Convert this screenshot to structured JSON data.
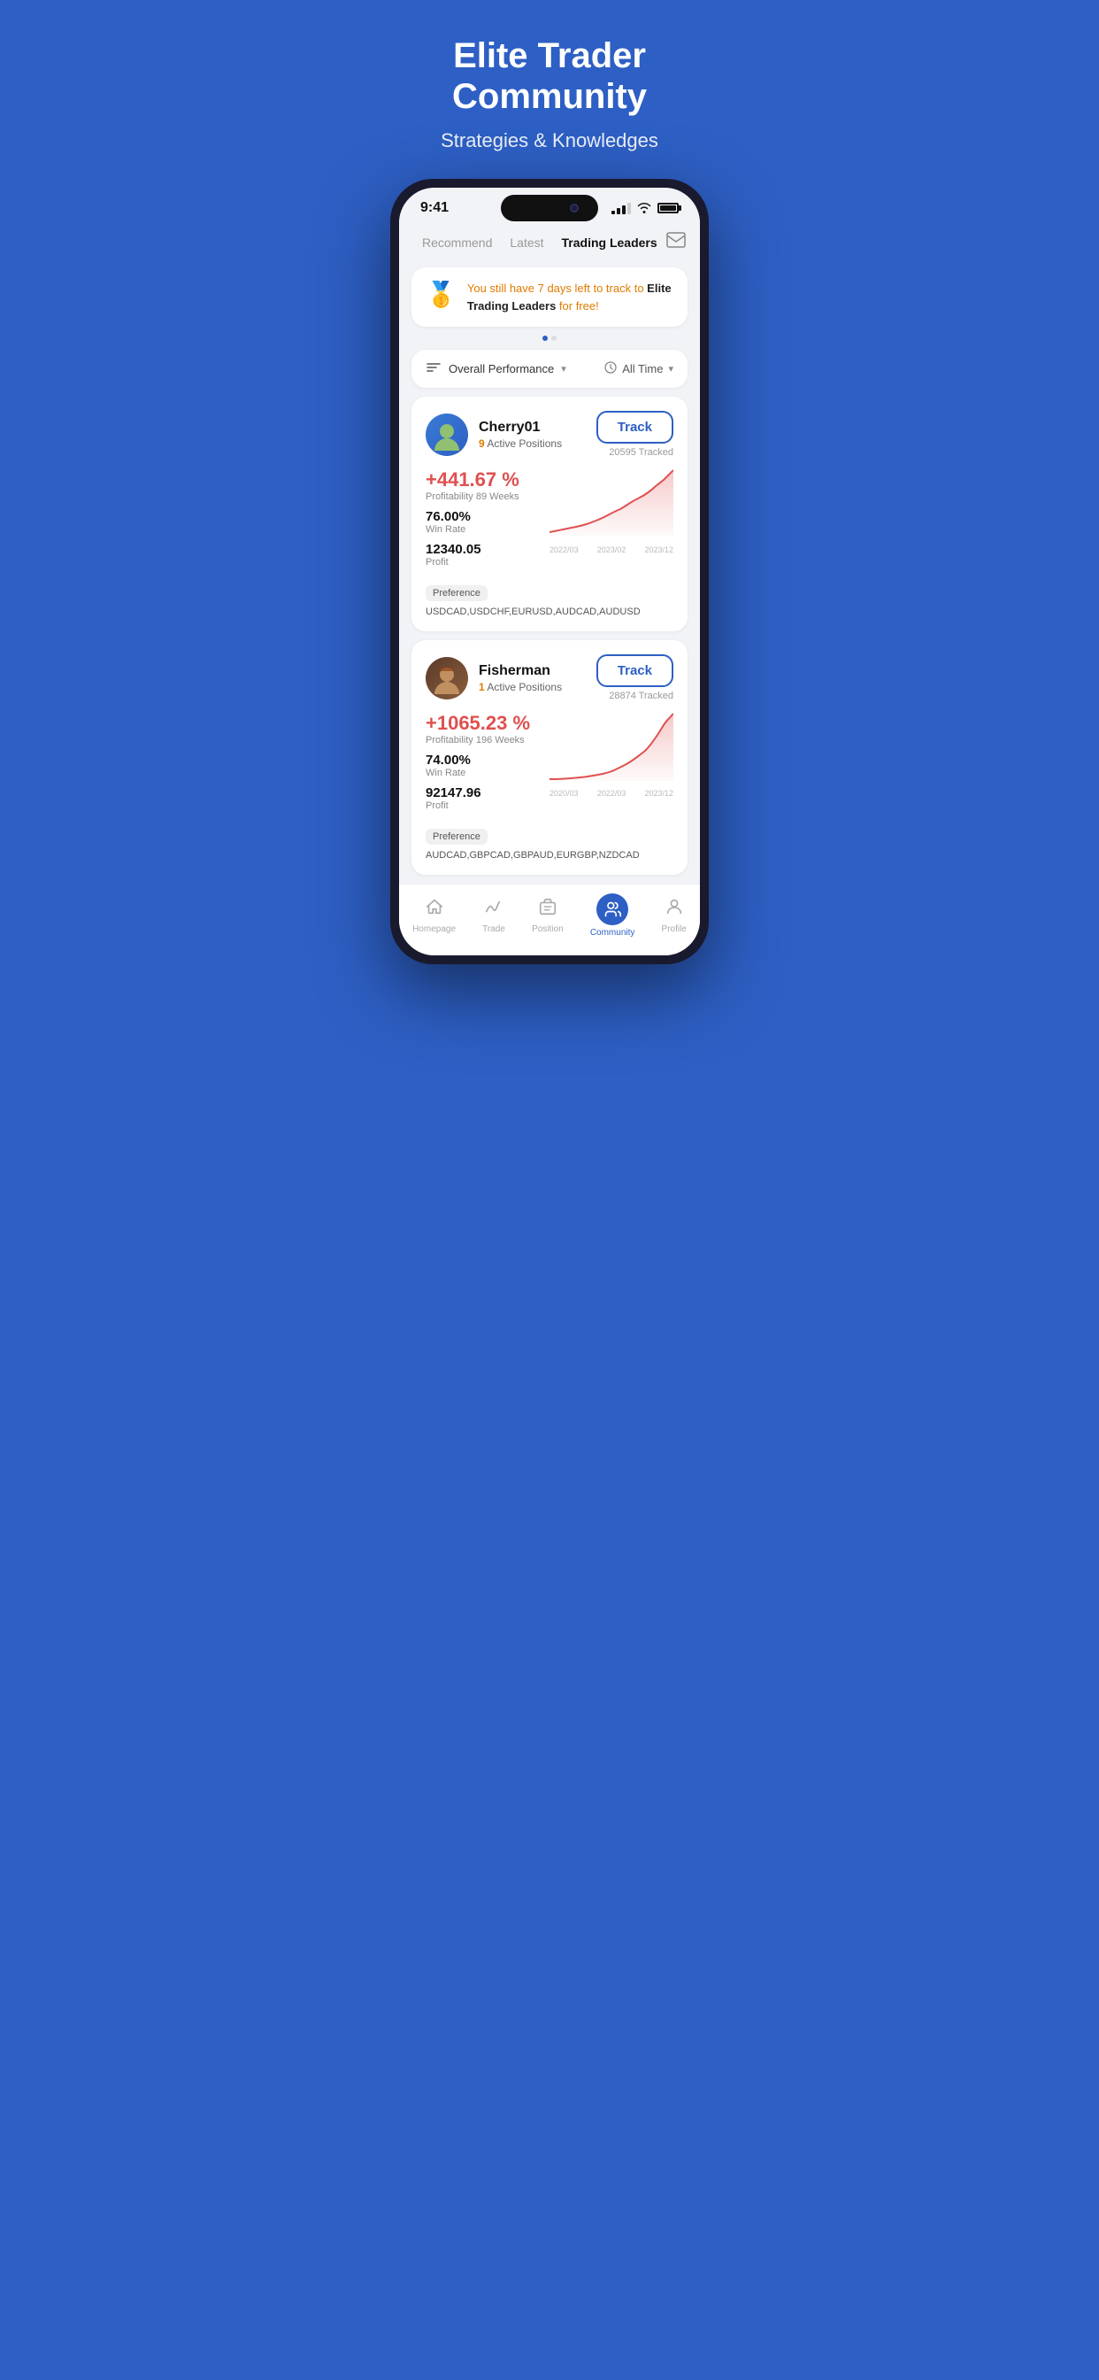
{
  "hero": {
    "title": "Elite Trader\nCommunity",
    "subtitle": "Strategies & Knowledges"
  },
  "statusBar": {
    "time": "9:41"
  },
  "navTabs": {
    "tabs": [
      "Recommend",
      "Latest",
      "Trading Leaders"
    ],
    "activeTab": "Trading Leaders"
  },
  "promoBanner": {
    "medal": "🥇",
    "text_highlight": "You still have 7 days left to track to ",
    "text_bold": "Elite Trading Leaders",
    "text_end": " for free!"
  },
  "filterBar": {
    "performance_label": "Overall Performance",
    "time_label": "All Time"
  },
  "traders": [
    {
      "id": "cherry01",
      "name": "Cherry01",
      "active_positions": 9,
      "profit_pct": "+441.67 %",
      "profitability_label": "Profitability",
      "profitability_weeks": "89 Weeks",
      "win_rate": "76.00%",
      "win_rate_label": "Win Rate",
      "profit": "12340.05",
      "profit_label": "Profit",
      "track_label": "Track",
      "tracked_count": "20595 Tracked",
      "preference_label": "Preference",
      "preference_pairs": "USDCAD,USDCHF,EURUSD,AUDCAD,AUDUSD",
      "chart_dates": [
        "2022/03",
        "2023/02",
        "2023/12"
      ],
      "avatar_emoji": "🧑"
    },
    {
      "id": "fisherman",
      "name": "Fisherman",
      "active_positions": 1,
      "profit_pct": "+1065.23 %",
      "profitability_label": "Profitability",
      "profitability_weeks": "196 Weeks",
      "win_rate": "74.00%",
      "win_rate_label": "Win Rate",
      "profit": "92147.96",
      "profit_label": "Profit",
      "track_label": "Track",
      "tracked_count": "28874 Tracked",
      "preference_label": "Preference",
      "preference_pairs": "AUDCAD,GBPCAD,GBPAUD,EURGBP,NZDCAD",
      "chart_dates": [
        "2020/03",
        "2022/03",
        "2023/12"
      ],
      "avatar_emoji": "🧔"
    }
  ],
  "bottomNav": {
    "items": [
      {
        "id": "homepage",
        "label": "Homepage",
        "icon": "home"
      },
      {
        "id": "trade",
        "label": "Trade",
        "icon": "chart"
      },
      {
        "id": "position",
        "label": "Position",
        "icon": "briefcase"
      },
      {
        "id": "community",
        "label": "Community",
        "icon": "community",
        "active": true
      },
      {
        "id": "profile",
        "label": "Profile",
        "icon": "person"
      }
    ]
  }
}
